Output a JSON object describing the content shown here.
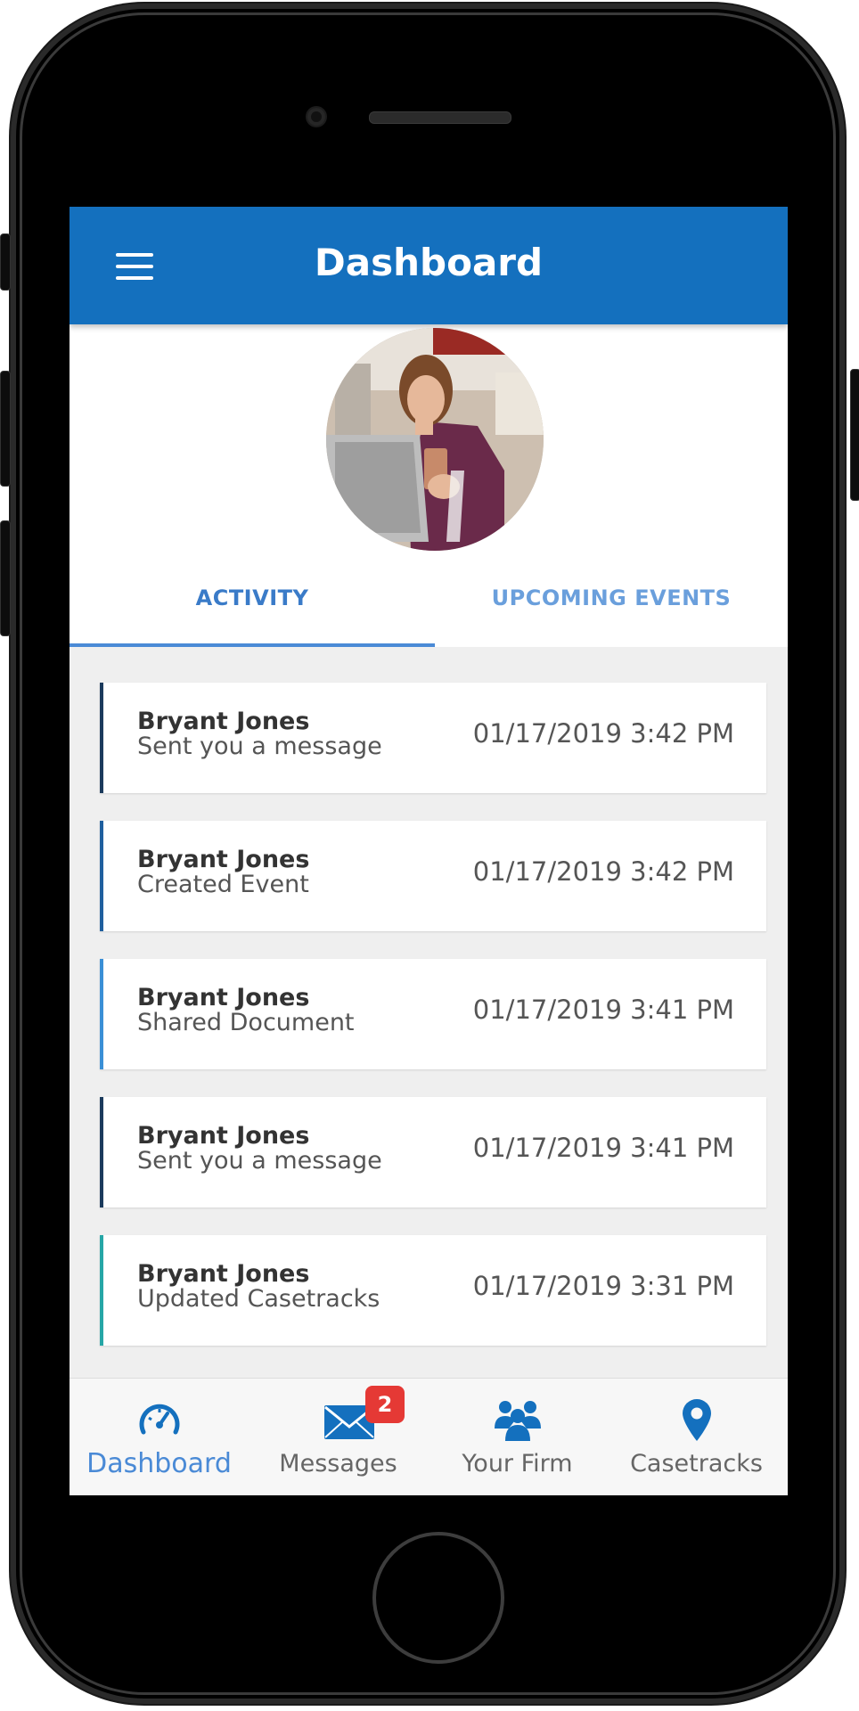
{
  "appbar": {
    "title": "Dashboard"
  },
  "tabs": [
    {
      "label": "ACTIVITY",
      "active": true
    },
    {
      "label": "UPCOMING EVENTS",
      "active": false
    }
  ],
  "activity": [
    {
      "name": "Bryant Jones",
      "action": "Sent you a message",
      "time": "01/17/2019 3:42 PM",
      "accent": "#1b3a5c"
    },
    {
      "name": "Bryant Jones",
      "action": "Created Event",
      "time": "01/17/2019 3:42 PM",
      "accent": "#1f5f9e"
    },
    {
      "name": "Bryant Jones",
      "action": "Shared Document",
      "time": "01/17/2019 3:41 PM",
      "accent": "#3a8fd6"
    },
    {
      "name": "Bryant Jones",
      "action": "Sent you a message",
      "time": "01/17/2019 3:41 PM",
      "accent": "#1b3a5c"
    },
    {
      "name": "Bryant Jones",
      "action": "Updated Casetracks",
      "time": "01/17/2019 3:31 PM",
      "accent": "#26a6a6"
    }
  ],
  "bottom_nav": [
    {
      "label": "Dashboard",
      "icon": "speedometer-icon",
      "active": true
    },
    {
      "label": "Messages",
      "icon": "envelope-icon",
      "badge": "2"
    },
    {
      "label": "Your Firm",
      "icon": "group-icon"
    },
    {
      "label": "Casetracks",
      "icon": "map-pin-icon"
    }
  ],
  "colors": {
    "primary": "#1470be",
    "active": "#4a8ad6",
    "badge": "#e53935"
  }
}
